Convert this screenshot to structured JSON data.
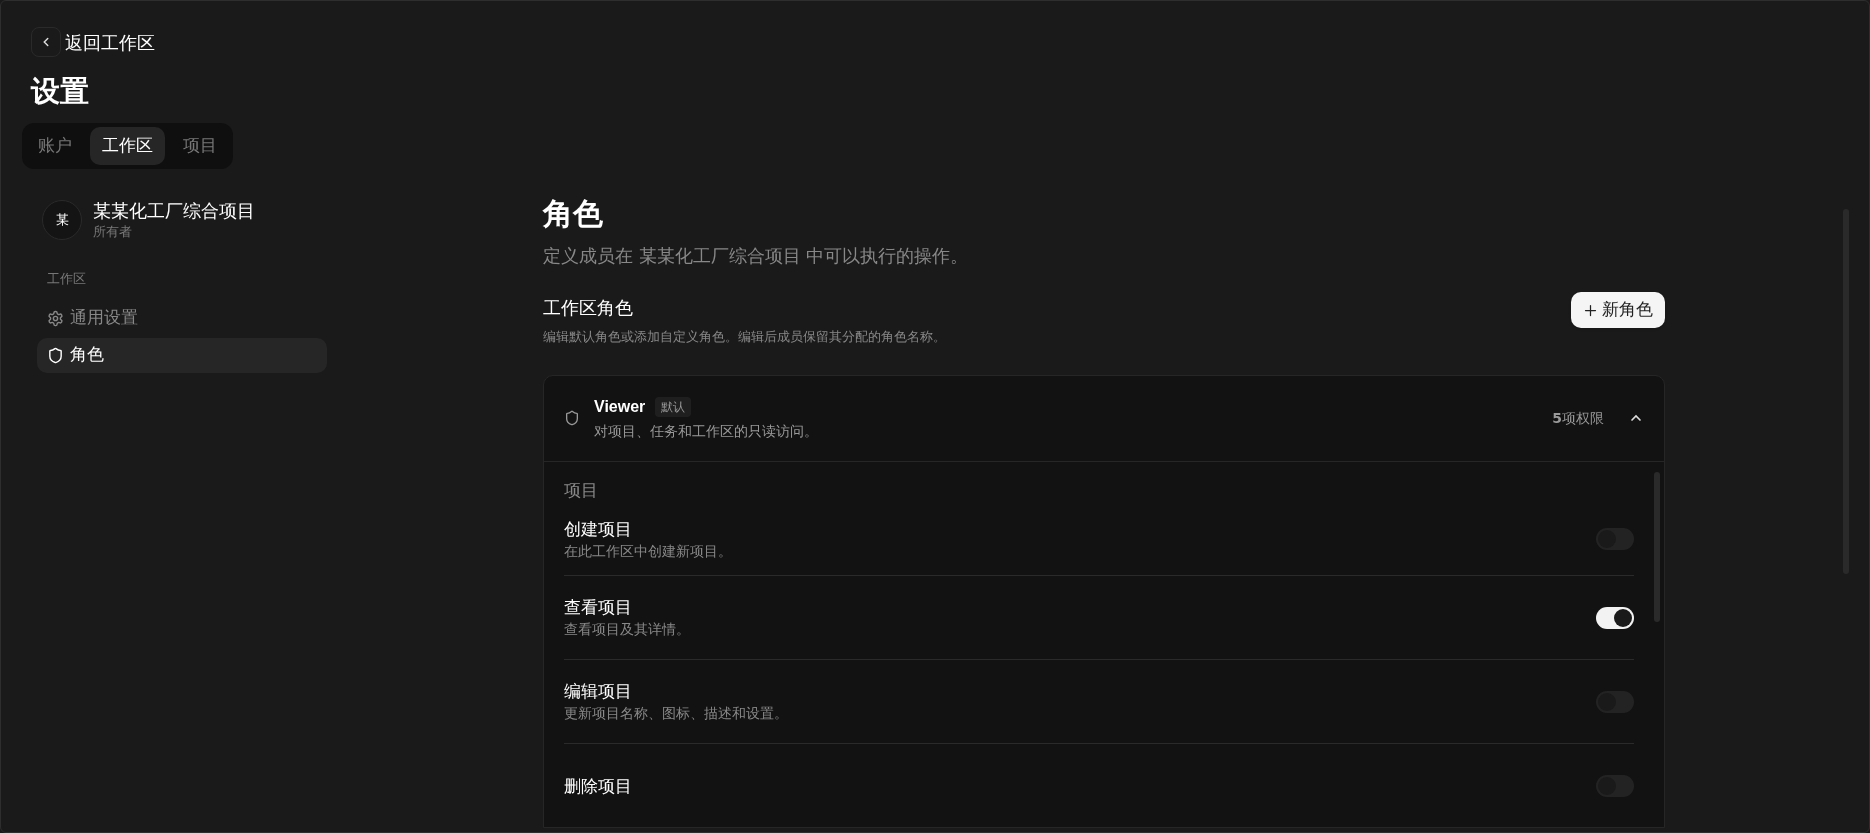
{
  "back_button": {
    "label": "返回工作区"
  },
  "page_title": "设置",
  "tabs": [
    {
      "label": "账户",
      "selected": false
    },
    {
      "label": "工作区",
      "selected": true
    },
    {
      "label": "项目",
      "selected": false
    }
  ],
  "workspace": {
    "avatar": "某",
    "name": "某某化工厂综合项目",
    "role": "所有者"
  },
  "sidebar": {
    "section": "工作区",
    "items": [
      {
        "label": "通用设置",
        "kind": "gear",
        "selected": false
      },
      {
        "label": "角色",
        "kind": "shield",
        "selected": true
      }
    ]
  },
  "main": {
    "title": "角色",
    "description": "定义成员在 某某化工厂综合项目 中可以执行的操作。",
    "section_title": "工作区角色",
    "section_description": "编辑默认角色或添加自定义角色。编辑后成员保留其分配的角色名称。",
    "new_role_button": {
      "label": "新角色"
    }
  },
  "roles": [
    {
      "name": "Viewer",
      "badge": "默认",
      "description": "对项目、任务和工作区的只读访问。",
      "permission_count": "**5**项权限",
      "expanded": true,
      "groups": [
        {
          "title": "项目",
          "permissions": [
            {
              "name": "创建项目",
              "description": "在此工作区中创建新项目。",
              "on": false
            },
            {
              "name": "查看项目",
              "description": "查看项目及其详情。",
              "on": true
            },
            {
              "name": "编辑项目",
              "description": "更新项目名称、图标、描述和设置。",
              "on": false
            },
            {
              "name": "删除项目",
              "on": false
            }
          ]
        }
      ]
    }
  ]
}
